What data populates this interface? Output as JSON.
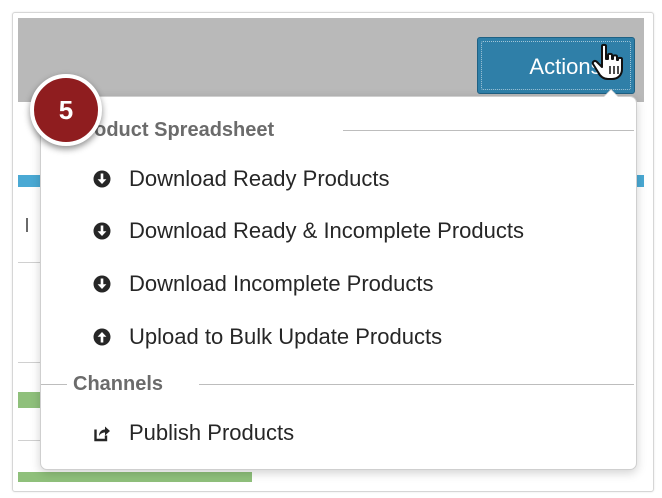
{
  "toolbar": {
    "actions_label": "Actions"
  },
  "step_badge": "5",
  "dropdown": {
    "sections": [
      {
        "title": "Product Spreadsheet",
        "items": [
          {
            "label": "Download Ready Products",
            "icon": "download-circle-icon"
          },
          {
            "label": "Download Ready & Incomplete Products",
            "icon": "download-circle-icon"
          },
          {
            "label": "Download Incomplete Products",
            "icon": "download-circle-icon"
          },
          {
            "label": "Upload to Bulk Update Products",
            "icon": "upload-circle-icon"
          }
        ]
      },
      {
        "title": "Channels",
        "items": [
          {
            "label": "Publish Products",
            "icon": "share-icon"
          }
        ]
      }
    ]
  },
  "colors": {
    "actions_button": "#2f7fa8",
    "badge": "#8f1d1f",
    "header_bar": "#b9b9b9",
    "menu_text": "#262626",
    "section_text": "#6b6b6b"
  }
}
